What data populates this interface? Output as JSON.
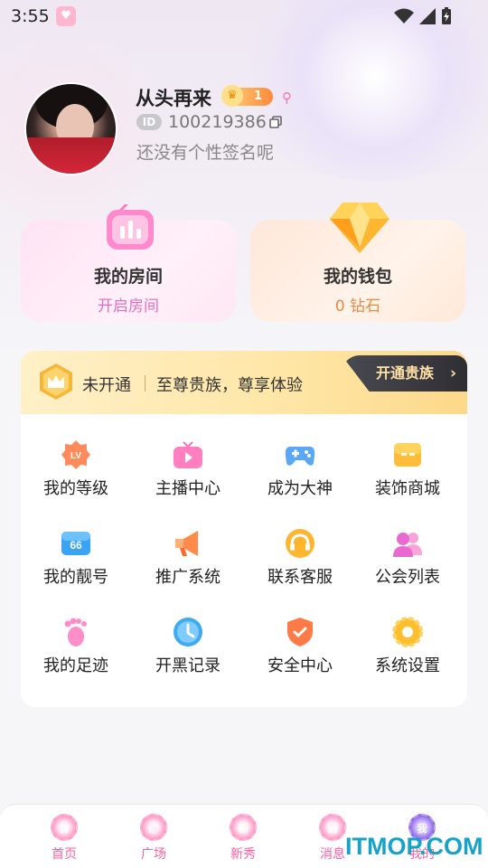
{
  "status_bar": {
    "time": "3:55"
  },
  "profile": {
    "username": "从头再来",
    "level": "1",
    "id_tag": "ID",
    "user_id": "100219386",
    "signature": "还没有个性签名呢"
  },
  "cards": {
    "room": {
      "title": "我的房间",
      "sub": "开启房间"
    },
    "wallet": {
      "title": "我的钱包",
      "sub": "0 钻石"
    }
  },
  "vip": {
    "status": "未开通",
    "desc": "至尊贵族，尊享体验",
    "button": "开通贵族"
  },
  "grid": [
    {
      "label": "我的等级",
      "icon": "level-icon"
    },
    {
      "label": "主播中心",
      "icon": "tv-icon"
    },
    {
      "label": "成为大神",
      "icon": "gamepad-icon"
    },
    {
      "label": "装饰商城",
      "icon": "shop-icon"
    },
    {
      "label": "我的靓号",
      "icon": "number-icon"
    },
    {
      "label": "推广系统",
      "icon": "megaphone-icon"
    },
    {
      "label": "联系客服",
      "icon": "headset-icon"
    },
    {
      "label": "公会列表",
      "icon": "group-icon"
    },
    {
      "label": "我的足迹",
      "icon": "footprint-icon"
    },
    {
      "label": "开黑记录",
      "icon": "clock-icon"
    },
    {
      "label": "安全中心",
      "icon": "shield-icon"
    },
    {
      "label": "系统设置",
      "icon": "gear-icon"
    }
  ],
  "nav": [
    {
      "label": "首页",
      "glyph": "首"
    },
    {
      "label": "广场",
      "glyph": "广"
    },
    {
      "label": "新秀",
      "glyph": "新"
    },
    {
      "label": "消息",
      "glyph": "消"
    },
    {
      "label": "我的",
      "glyph": "我"
    }
  ],
  "watermark": "ITMOP.COM",
  "colors": {
    "accent_pink": "#ff5fa0",
    "vip_gold": "#ffe6a6",
    "wallet_orange": "#e88a45"
  }
}
